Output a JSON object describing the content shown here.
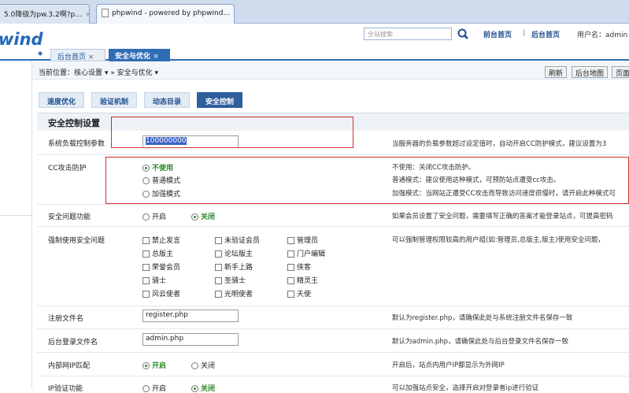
{
  "browser": {
    "tabs": [
      {
        "label": "5.0降级为pw.3.2啊?p…",
        "close": "×"
      },
      {
        "label": "phpwind - powered by phpwind…",
        "close": "×"
      }
    ]
  },
  "header": {
    "logo": "wind",
    "search_placeholder": "全站搜索",
    "links": [
      "前台首页",
      "后台首页"
    ],
    "user": "用户名：admin",
    "separator": "|"
  },
  "admin_tabs": [
    {
      "label": "后台首页",
      "close": "×"
    },
    {
      "label": "安全与优化",
      "close": "×"
    }
  ],
  "breadcrumb": "当前位置：核心设置 ▾ » 安全与优化 ▾",
  "toolbar": {
    "refresh": "刷新",
    "sitemap": "后台地图",
    "page": "页面"
  },
  "subtabs": [
    "速度优化",
    "验证机制",
    "动态目录",
    "安全控制"
  ],
  "section_title": "安全控制设置",
  "rows": {
    "load": {
      "label": "系统负载控制参数",
      "value": "100000000",
      "desc": "当服务器的负载参数超过设定值时，自动开启CC防护模式，建议设置为3"
    },
    "cc": {
      "label": "CC攻击防护",
      "options": [
        "不使用",
        "普通模式",
        "加强模式"
      ],
      "desc": [
        "不使用：关闭CC攻击防护。",
        "普通模式：建议使用这种模式，可预防站点遭受cc攻击。",
        "加强模式：当网站正遭受CC攻击而导致访问速度很慢时，请开启此种模式可"
      ]
    },
    "question": {
      "label": "安全问题功能",
      "options": [
        "开启",
        "关闭"
      ],
      "desc": "如果会员设置了安全问题，需要填写正确的答案才能登录站点，可提高密码"
    },
    "force": {
      "label": "强制使用安全问题",
      "groups": [
        "禁止发言",
        "未验证会员",
        "管理员",
        "总版主",
        "论坛版主",
        "门户编辑",
        "荣誉会员",
        "新手上路",
        "侠客",
        "骑士",
        "圣骑士",
        "精灵王",
        "风云使者",
        "光明使者",
        "天使"
      ],
      "desc": "可以强制管理权限较高的用户组(如:管理员,总版主,版主)使用安全问题，"
    },
    "register": {
      "label": "注册文件名",
      "value": "register.php",
      "desc": "默认为register.php，请确保此处与系统注册文件名保存一致"
    },
    "admin_login": {
      "label": "后台登录文件名",
      "value": "admin.php",
      "desc": "默认为admin.php，请确保此处与后台登录文件名保存一致"
    },
    "intranet": {
      "label": "内部网IP匹配",
      "options": [
        "开启",
        "关闭"
      ],
      "desc": "开启后，站点内用户IP都显示为外网IP"
    },
    "ipverify": {
      "label": "IP验证功能",
      "options": [
        "开启",
        "关闭"
      ],
      "desc": "可以加强站点安全，选择开启对登录者ip进行验证"
    }
  },
  "colors": {
    "accent": "#2f5f9c",
    "highlight": "#d23030",
    "selected": "#2a8a2a"
  }
}
